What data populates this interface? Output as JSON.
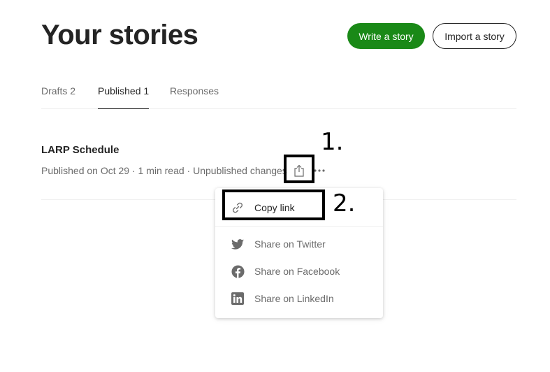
{
  "header": {
    "title": "Your stories",
    "write_label": "Write a story",
    "import_label": "Import a story"
  },
  "tabs": [
    {
      "label": "Drafts 2",
      "active": false
    },
    {
      "label": "Published 1",
      "active": true
    },
    {
      "label": "Responses",
      "active": false
    }
  ],
  "story": {
    "title": "LARP Schedule",
    "meta": "Published on Oct 29 · 1 min read · Unpublished changes"
  },
  "annotations": {
    "step1": "1.",
    "step2": "2."
  },
  "share_menu": {
    "items": [
      {
        "label": "Copy link",
        "icon": "link-icon"
      },
      {
        "label": "Share on Twitter",
        "icon": "twitter-icon"
      },
      {
        "label": "Share on Facebook",
        "icon": "facebook-icon"
      },
      {
        "label": "Share on LinkedIn",
        "icon": "linkedin-icon"
      }
    ]
  },
  "colors": {
    "accent_green": "#1a8917",
    "text_primary": "#242424",
    "text_secondary": "#6b6b6b",
    "divider": "#f0f0f0"
  }
}
